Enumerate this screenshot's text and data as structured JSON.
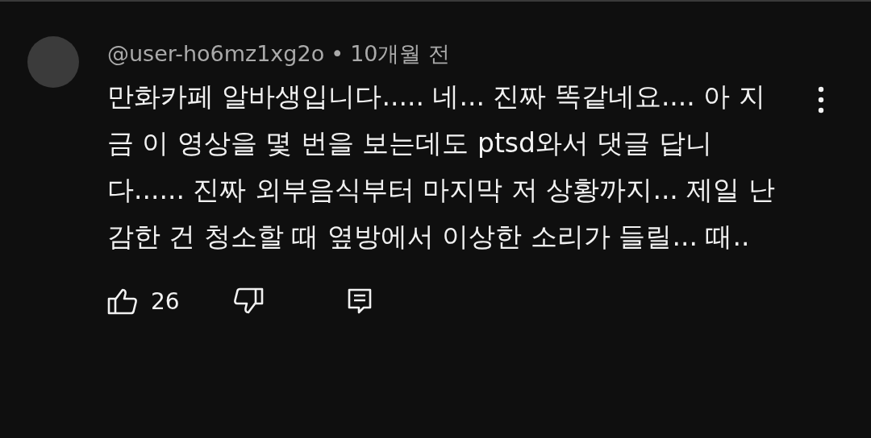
{
  "comment": {
    "author": "@user-ho6mz1xg2o",
    "separator": "•",
    "time": "10개월 전",
    "text": "만화카페 알바생입니다..... 네... 진짜 똑같네요.... 아 지금 이 영상을 몇 번을 보는데도 ptsd와서 댓글 답니다...... 진짜 외부음식부터 마지막 저 상황까지... 제일 난감한 건 청소할 때 옆방에서 이상한 소리가 들릴... 때..",
    "likes": "26"
  }
}
